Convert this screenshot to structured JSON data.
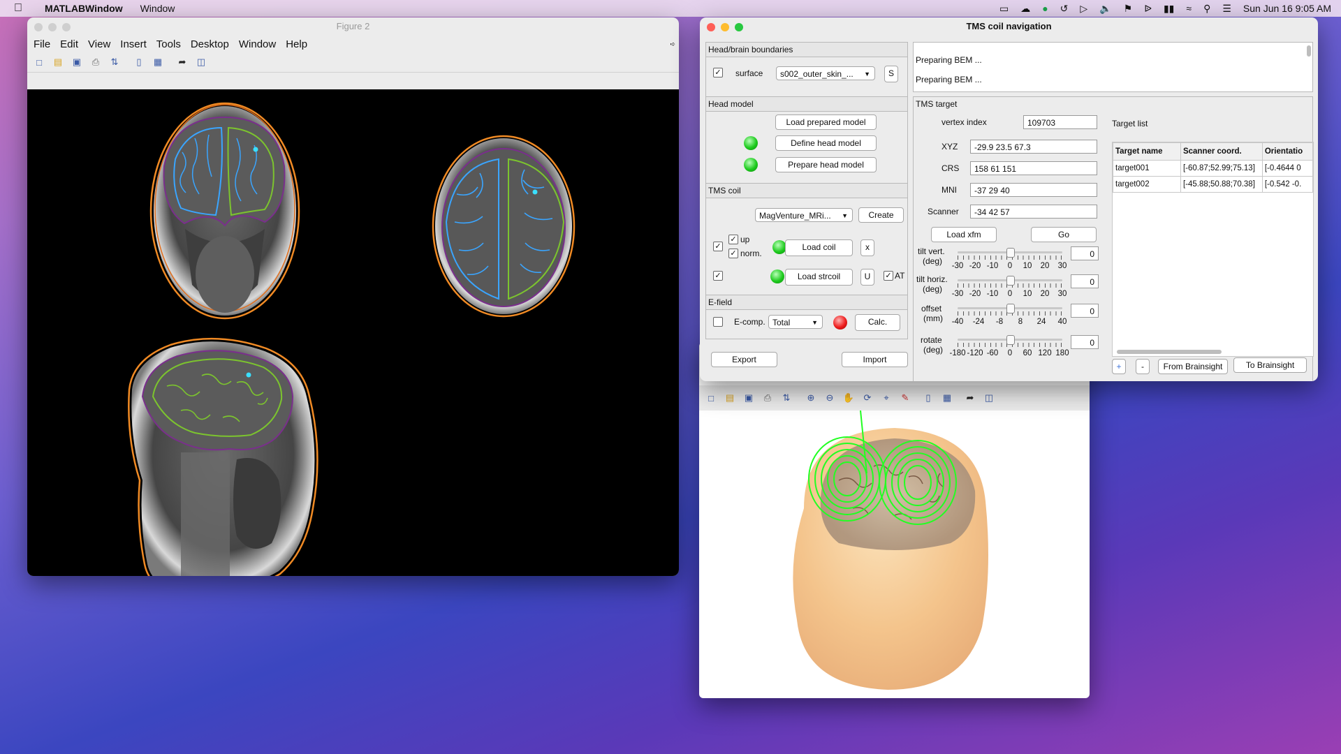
{
  "menubar": {
    "app": "MATLABWindow",
    "menu": "Window",
    "clock": "Sun Jun 16  9:05 AM"
  },
  "figure2": {
    "title": "Figure 2",
    "menus": [
      "File",
      "Edit",
      "View",
      "Insert",
      "Tools",
      "Desktop",
      "Window",
      "Help"
    ]
  },
  "tms": {
    "title": "TMS coil navigation",
    "head_brain": {
      "title": "Head/brain boundaries",
      "surface_label": "surface",
      "surface_value": "s002_outer_skin_...",
      "s_button": "S"
    },
    "log": [
      "Preparing BEM ...",
      "Preparing BEM ..."
    ],
    "head_model": {
      "title": "Head model",
      "load_prepared": "Load prepared model",
      "define": "Define head model",
      "prepare": "Prepare head model"
    },
    "coil": {
      "title": "TMS coil",
      "coil_value": "MagVenture_MRi...",
      "create": "Create",
      "up": "up",
      "norm": "norm.",
      "load_coil": "Load coil",
      "x": "x",
      "load_strcoil": "Load strcoil",
      "u": "U",
      "at": "AT"
    },
    "efield": {
      "title": "E-field",
      "ecomp": "E-comp.",
      "ecomp_value": "Total",
      "calc": "Calc."
    },
    "export": "Export",
    "import": "Import",
    "target": {
      "title": "TMS target",
      "vertex_label": "vertex index",
      "vertex_value": "109703",
      "xyz_label": "XYZ",
      "xyz_value": "-29.9  23.5  67.3",
      "crs_label": "CRS",
      "crs_value": "158  61 151",
      "mni_label": "MNI",
      "mni_value": "-37  29  40",
      "scanner_label": "Scanner",
      "scanner_value": "-34  42  57",
      "load_xfm": "Load xfm",
      "go": "Go",
      "sliders": [
        {
          "label1": "tilt vert.",
          "label2": "(deg)",
          "value": "0",
          "level": 0.5,
          "ticks": [
            "-30",
            "-20",
            "-10",
            "0",
            "10",
            "20",
            "30"
          ]
        },
        {
          "label1": "tilt horiz.",
          "label2": "(deg)",
          "value": "0",
          "level": 0.5,
          "ticks": [
            "-30",
            "-20",
            "-10",
            "0",
            "10",
            "20",
            "30"
          ]
        },
        {
          "label1": "offset",
          "label2": "(mm)",
          "value": "0",
          "level": 0.5,
          "ticks": [
            "-40",
            "-24",
            "-8",
            "8",
            "24",
            "40"
          ]
        },
        {
          "label1": "rotate",
          "label2": "(deg)",
          "value": "0",
          "level": 0.5,
          "ticks": [
            "-180",
            "-120",
            "-60",
            "0",
            "60",
            "120",
            "180"
          ]
        }
      ]
    },
    "target_list": {
      "title": "Target list",
      "columns": [
        "Target name",
        "Scanner coord.",
        "Orientatio"
      ],
      "rows": [
        [
          "target001",
          "[-60.87;52.99;75.13]",
          "[-0.4644 0"
        ],
        [
          "target002",
          "[-45.88;50.88;70.38]",
          "[-0.542 -0."
        ]
      ],
      "plus": "+",
      "minus": "-",
      "from_brainsight": "From Brainsight",
      "to_brainsight": "To Brainsight"
    }
  },
  "colors": {
    "green_indicator": "#1ecb1e",
    "red_indicator": "#ee1d1d",
    "coil_green": "#22ff22",
    "contour_orange": "#f08a24",
    "contour_purple": "#7a2f8c",
    "contour_blue": "#3aa5ff",
    "contour_green": "#7cc42e"
  }
}
